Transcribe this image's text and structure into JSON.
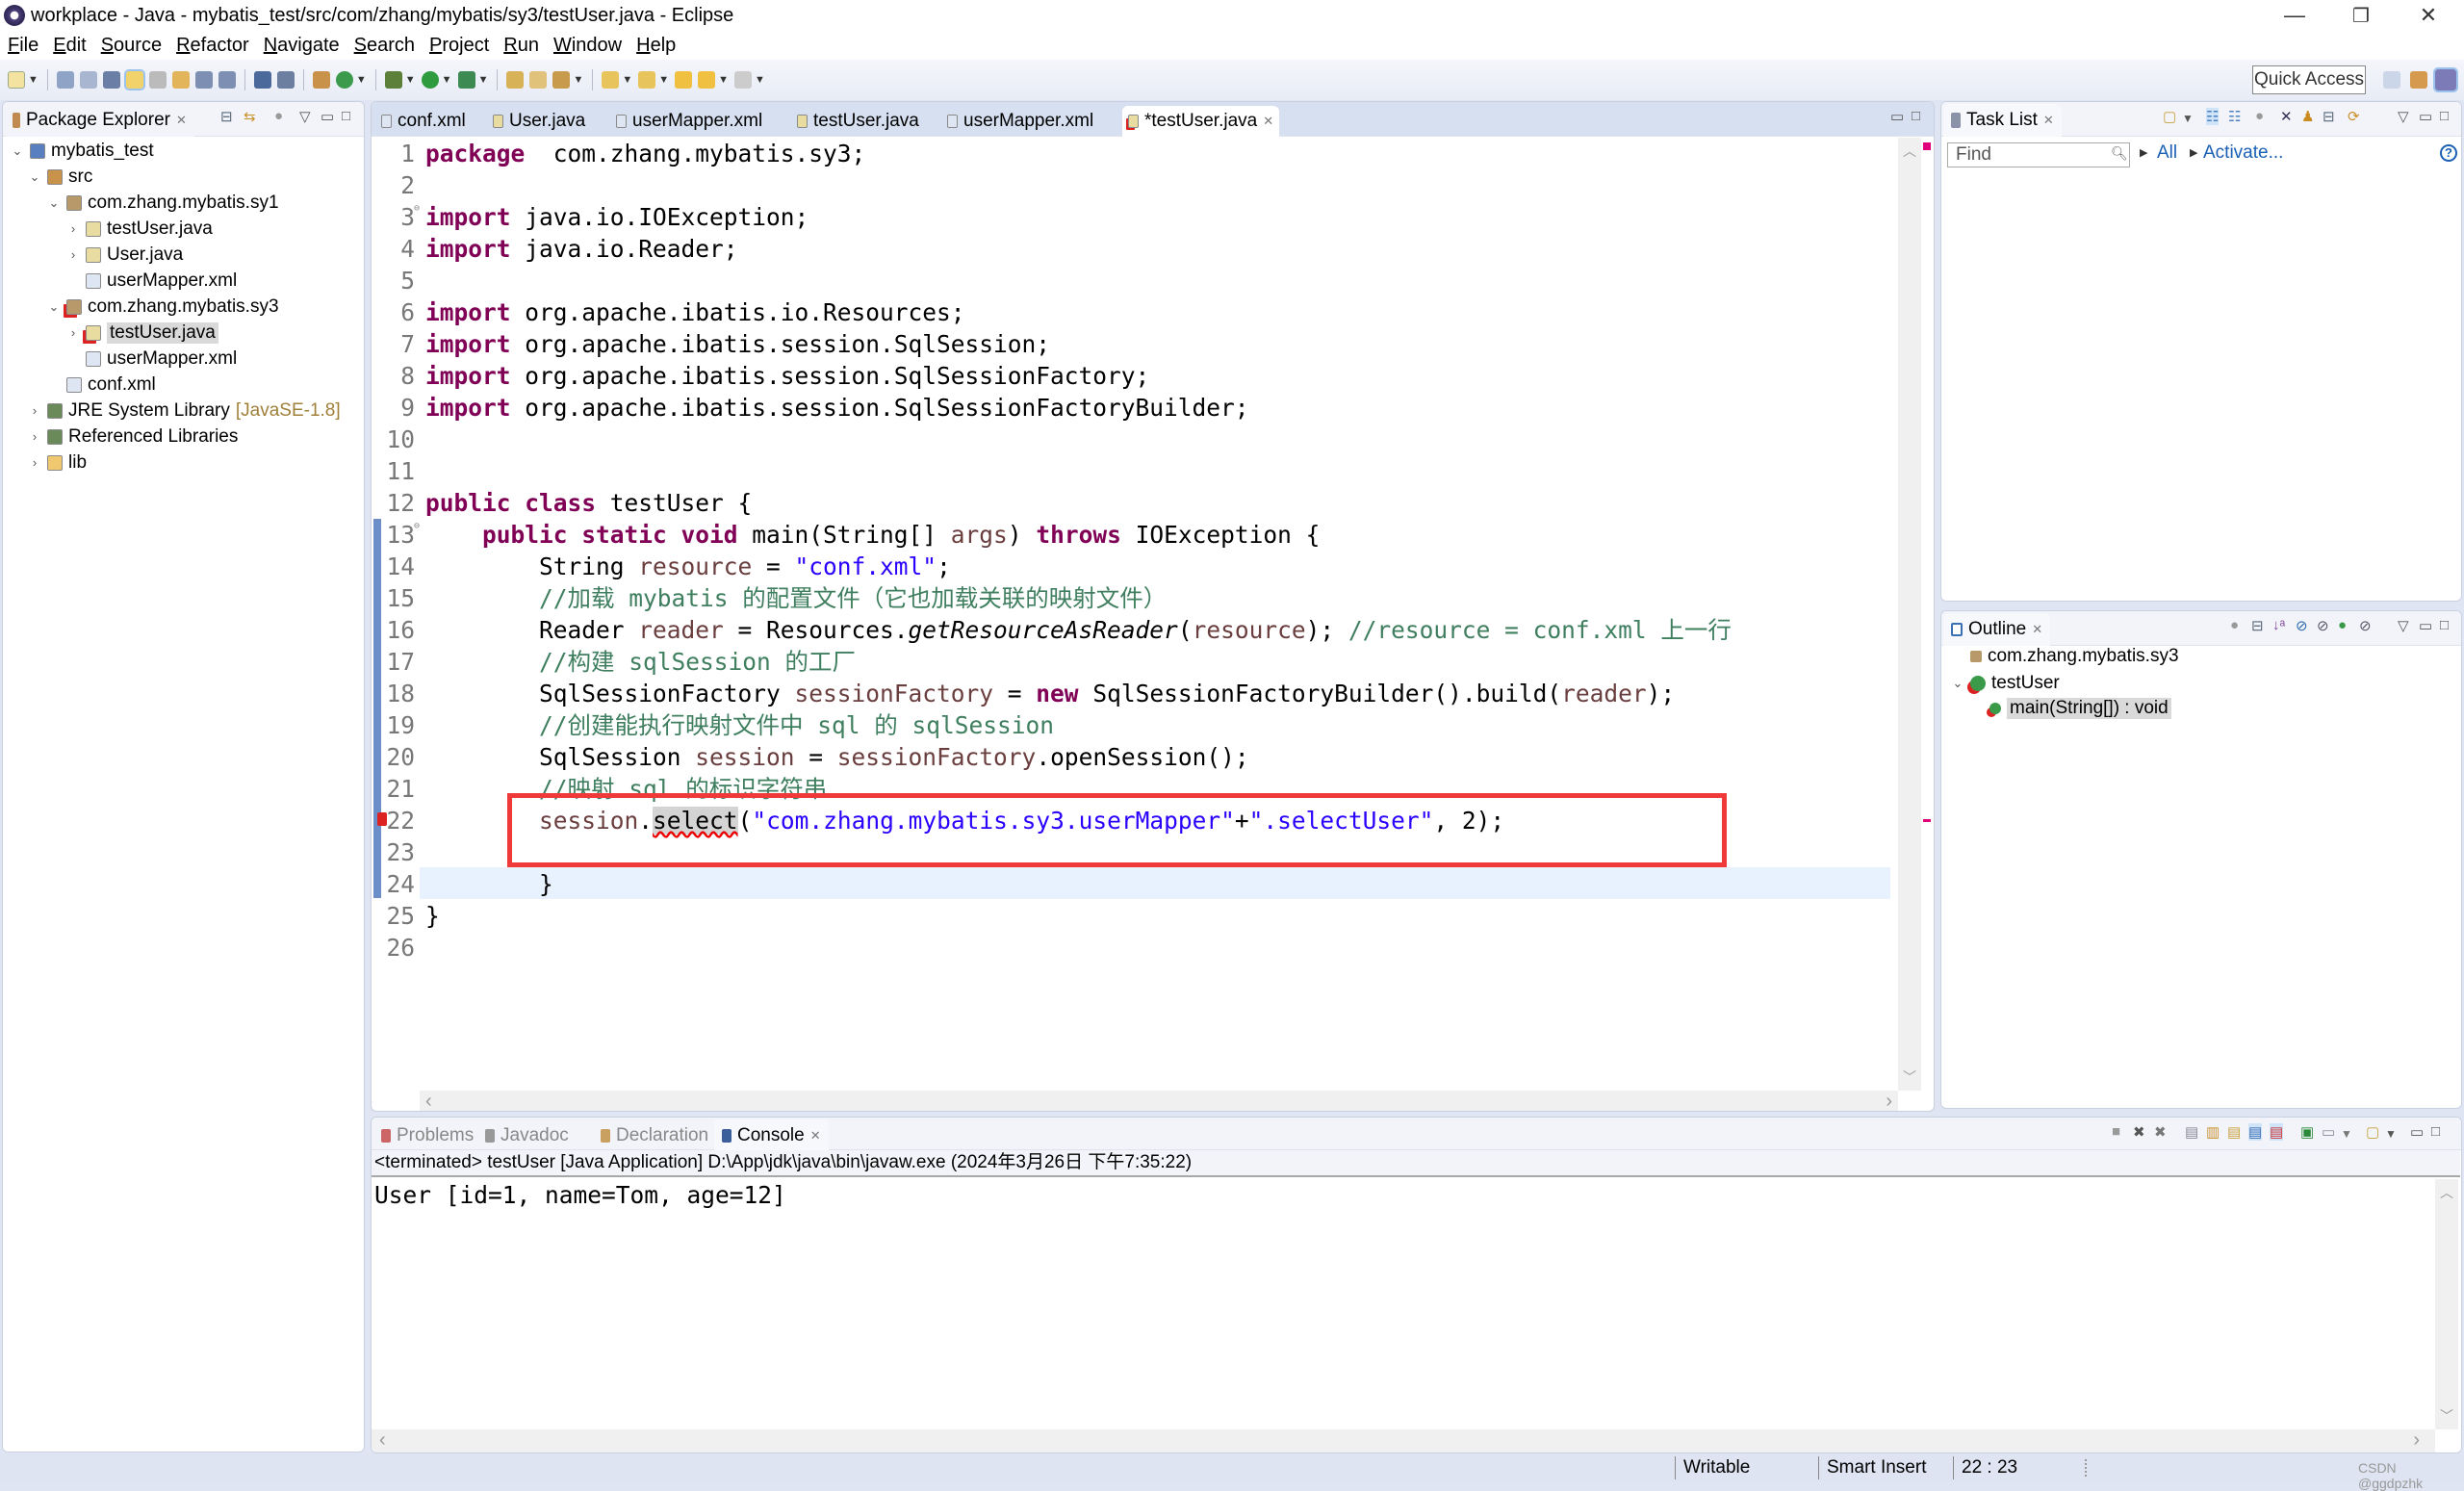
{
  "window": {
    "title": "workplace - Java - mybatis_test/src/com/zhang/mybatis/sy3/testUser.java - Eclipse",
    "minimize": "—",
    "maximize": "❐",
    "close": "✕"
  },
  "menu": [
    "File",
    "Edit",
    "Source",
    "Refactor",
    "Navigate",
    "Search",
    "Project",
    "Run",
    "Window",
    "Help"
  ],
  "toolbar": {
    "quick_access": "Quick Access"
  },
  "package_explorer": {
    "title": "Package Explorer",
    "items": [
      {
        "label": "mybatis_test",
        "level": 0,
        "arrow": "⌄",
        "icon": "java-project-icon"
      },
      {
        "label": "src",
        "level": 1,
        "arrow": "⌄",
        "icon": "source-folder-icon"
      },
      {
        "label": "com.zhang.mybatis.sy1",
        "level": 2,
        "arrow": "⌄",
        "icon": "package-icon"
      },
      {
        "label": "testUser.java",
        "level": 3,
        "arrow": "›",
        "icon": "java-file-icon"
      },
      {
        "label": "User.java",
        "level": 3,
        "arrow": "›",
        "icon": "java-file-icon"
      },
      {
        "label": "userMapper.xml",
        "level": 3,
        "arrow": "",
        "icon": "xml-file-icon"
      },
      {
        "label": "com.zhang.mybatis.sy3",
        "level": 2,
        "arrow": "⌄",
        "icon": "package-error-icon"
      },
      {
        "label": "testUser.java",
        "level": 3,
        "arrow": "›",
        "icon": "java-file-error-icon",
        "selected": true
      },
      {
        "label": "userMapper.xml",
        "level": 3,
        "arrow": "",
        "icon": "xml-file-icon"
      },
      {
        "label": "conf.xml",
        "level": 2,
        "arrow": "",
        "icon": "xml-file-icon"
      },
      {
        "label": "JRE System Library",
        "suffix": "[JavaSE-1.8]",
        "level": 1,
        "arrow": "›",
        "icon": "library-icon"
      },
      {
        "label": "Referenced Libraries",
        "level": 1,
        "arrow": "›",
        "icon": "library-icon"
      },
      {
        "label": "lib",
        "level": 1,
        "arrow": "›",
        "icon": "folder-icon"
      }
    ]
  },
  "editor": {
    "tabs": [
      {
        "label": "conf.xml",
        "icon": "xml-file-icon"
      },
      {
        "label": "User.java",
        "icon": "java-file-icon"
      },
      {
        "label": "userMapper.xml",
        "icon": "xml-file-icon"
      },
      {
        "label": "testUser.java",
        "icon": "java-file-icon"
      },
      {
        "label": "userMapper.xml",
        "icon": "xml-file-icon"
      },
      {
        "label": "*testUser.java",
        "icon": "java-file-error-icon",
        "active": true
      }
    ],
    "current_line": 22,
    "highlight_box_color": "#f03a3a",
    "lines": [
      [
        [
          "kw",
          "package"
        ],
        [
          "",
          "  com.zhang.mybatis.sy3;"
        ]
      ],
      [],
      [
        [
          "kw",
          "import"
        ],
        [
          "",
          " java.io.IOException;"
        ]
      ],
      [
        [
          "kw",
          "import"
        ],
        [
          "",
          " java.io.Reader;"
        ]
      ],
      [],
      [
        [
          "kw",
          "import"
        ],
        [
          "",
          " org.apache.ibatis.io.Resources;"
        ]
      ],
      [
        [
          "kw",
          "import"
        ],
        [
          "",
          " org.apache.ibatis.session.SqlSession;"
        ]
      ],
      [
        [
          "kw",
          "import"
        ],
        [
          "",
          " org.apache.ibatis.session.SqlSessionFactory;"
        ]
      ],
      [
        [
          "kw",
          "import"
        ],
        [
          "",
          " org.apache.ibatis.session.SqlSessionFactoryBuilder;"
        ]
      ],
      [],
      [],
      [
        [
          "kw",
          "public class"
        ],
        [
          "",
          " testUser {"
        ]
      ],
      [
        [
          "",
          "    "
        ],
        [
          "kw",
          "public static void"
        ],
        [
          "",
          " main(String[] "
        ],
        [
          "var",
          "args"
        ],
        [
          "",
          ") "
        ],
        [
          "kw",
          "throws"
        ],
        [
          "",
          " IOException {"
        ]
      ],
      [
        [
          "",
          "        String "
        ],
        [
          "var",
          "resource"
        ],
        [
          "",
          " = "
        ],
        [
          "str",
          "\"conf.xml\""
        ],
        [
          "",
          ";"
        ]
      ],
      [
        [
          "",
          "        "
        ],
        [
          "cm",
          "//加载 mybatis 的配置文件（它也加载关联的映射文件）"
        ]
      ],
      [
        [
          "",
          "        Reader "
        ],
        [
          "var",
          "reader"
        ],
        [
          "",
          " = Resources."
        ],
        [
          "it",
          "getResourceAsReader"
        ],
        [
          "",
          "("
        ],
        [
          "var",
          "resource"
        ],
        [
          "",
          "); "
        ],
        [
          "cm",
          "//resource = conf.xml 上一行"
        ]
      ],
      [
        [
          "",
          "        "
        ],
        [
          "cm",
          "//构建 sqlSession 的工厂"
        ]
      ],
      [
        [
          "",
          "        SqlSessionFactory "
        ],
        [
          "var",
          "sessionFactory"
        ],
        [
          "",
          " = "
        ],
        [
          "kw",
          "new"
        ],
        [
          "",
          " SqlSessionFactoryBuilder().build("
        ],
        [
          "var",
          "reader"
        ],
        [
          "",
          ");"
        ]
      ],
      [
        [
          "",
          "        "
        ],
        [
          "cm",
          "//创建能执行映射文件中 sql 的 sqlSession"
        ]
      ],
      [
        [
          "",
          "        SqlSession "
        ],
        [
          "var",
          "session"
        ],
        [
          "",
          " = "
        ],
        [
          "var",
          "sessionFactory"
        ],
        [
          "",
          ".openSession();"
        ]
      ],
      [
        [
          "",
          "        "
        ],
        [
          "cm",
          "//映射 sql 的标识字符串"
        ]
      ],
      [
        [
          "",
          "        "
        ],
        [
          "var",
          "session"
        ],
        [
          "",
          "."
        ],
        [
          "err",
          "select"
        ],
        [
          "",
          "("
        ],
        [
          "str",
          "\"com.zhang.mybatis.sy3.userMapper\""
        ],
        [
          "",
          "+"
        ],
        [
          "str",
          "\".selectUser\""
        ],
        [
          "",
          ", 2);"
        ]
      ],
      [],
      [
        [
          "",
          "        }"
        ]
      ],
      [
        [
          "",
          "}"
        ]
      ],
      []
    ]
  },
  "task_list": {
    "title": "Task List",
    "find_placeholder": "Find",
    "all": "All",
    "activate": "Activate...",
    "help": "?"
  },
  "outline": {
    "title": "Outline",
    "items": [
      {
        "label": "com.zhang.mybatis.sy3",
        "icon": "package-icon"
      },
      {
        "label": "testUser",
        "icon": "class-error-icon",
        "arrow": "⌄"
      },
      {
        "label": "main(String[]) : void",
        "icon": "method-error-icon",
        "selected": true
      }
    ]
  },
  "console": {
    "tabs": [
      {
        "label": "Problems",
        "icon": "problems-icon"
      },
      {
        "label": "Javadoc",
        "icon": "javadoc-icon"
      },
      {
        "label": "Declaration",
        "icon": "declaration-icon"
      },
      {
        "label": "Console",
        "icon": "console-icon",
        "active": true
      }
    ],
    "status": "<terminated> testUser [Java Application] D:\\App\\jdk\\java\\bin\\javaw.exe (2024年3月26日 下午7:35:22)",
    "output": "User [id=1, name=Tom, age=12]"
  },
  "statusbar": {
    "writable": "Writable",
    "insert_mode": "Smart Insert",
    "position": "22 : 23",
    "watermark": "CSDN @ggdpzhk"
  }
}
